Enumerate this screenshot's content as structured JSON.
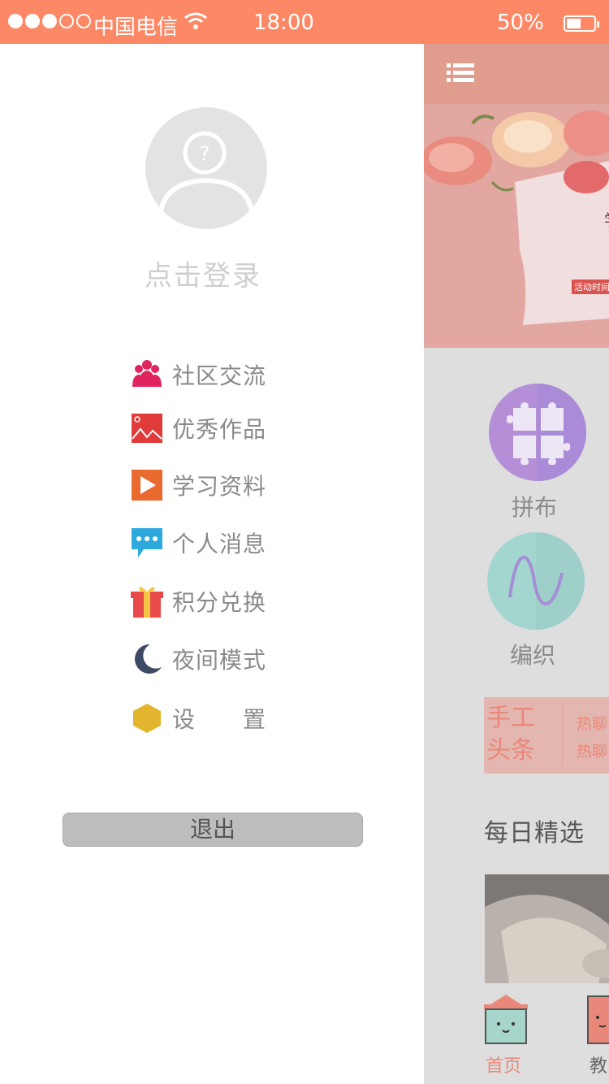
{
  "status_bar": {
    "carrier": "中国电信",
    "time": "18:00",
    "battery_percent": "50%",
    "signal_full": 3,
    "signal_total": 5
  },
  "drawer": {
    "login_prompt": "点击登录",
    "menu": [
      {
        "label": "社区交流",
        "icon": "community-icon",
        "color": "#e0245e"
      },
      {
        "label": "优秀作品",
        "icon": "gallery-icon",
        "color": "#e03a3a"
      },
      {
        "label": "学习资料",
        "icon": "play-icon",
        "color": "#e86a2e"
      },
      {
        "label": "个人消息",
        "icon": "message-icon",
        "color": "#2ea9dd"
      },
      {
        "label": "积分兑换",
        "icon": "gift-icon",
        "color": "#e84a4a"
      },
      {
        "label": "夜间模式",
        "icon": "moon-icon",
        "color": "#3d4a66"
      },
      {
        "label": "设　　置",
        "icon": "settings-hexagon-icon",
        "color": "#e3b52e"
      }
    ],
    "logout_label": "退出"
  },
  "main": {
    "banner_tag": "活动时间",
    "categories": [
      {
        "label": "拼布",
        "icon": "puzzle-icon",
        "color": "#b48fd8"
      },
      {
        "label": "编织",
        "icon": "wave-icon",
        "color": "#a2d6cf"
      }
    ],
    "news": {
      "title_line1": "手工",
      "title_line2": "头条",
      "item1": "热聊",
      "item2": "热聊"
    },
    "daily_title": "每日精选",
    "tabs": [
      {
        "label": "首页",
        "active": true,
        "color": "#e9887a"
      },
      {
        "label": "教",
        "active": false,
        "color": "#666666"
      }
    ]
  }
}
